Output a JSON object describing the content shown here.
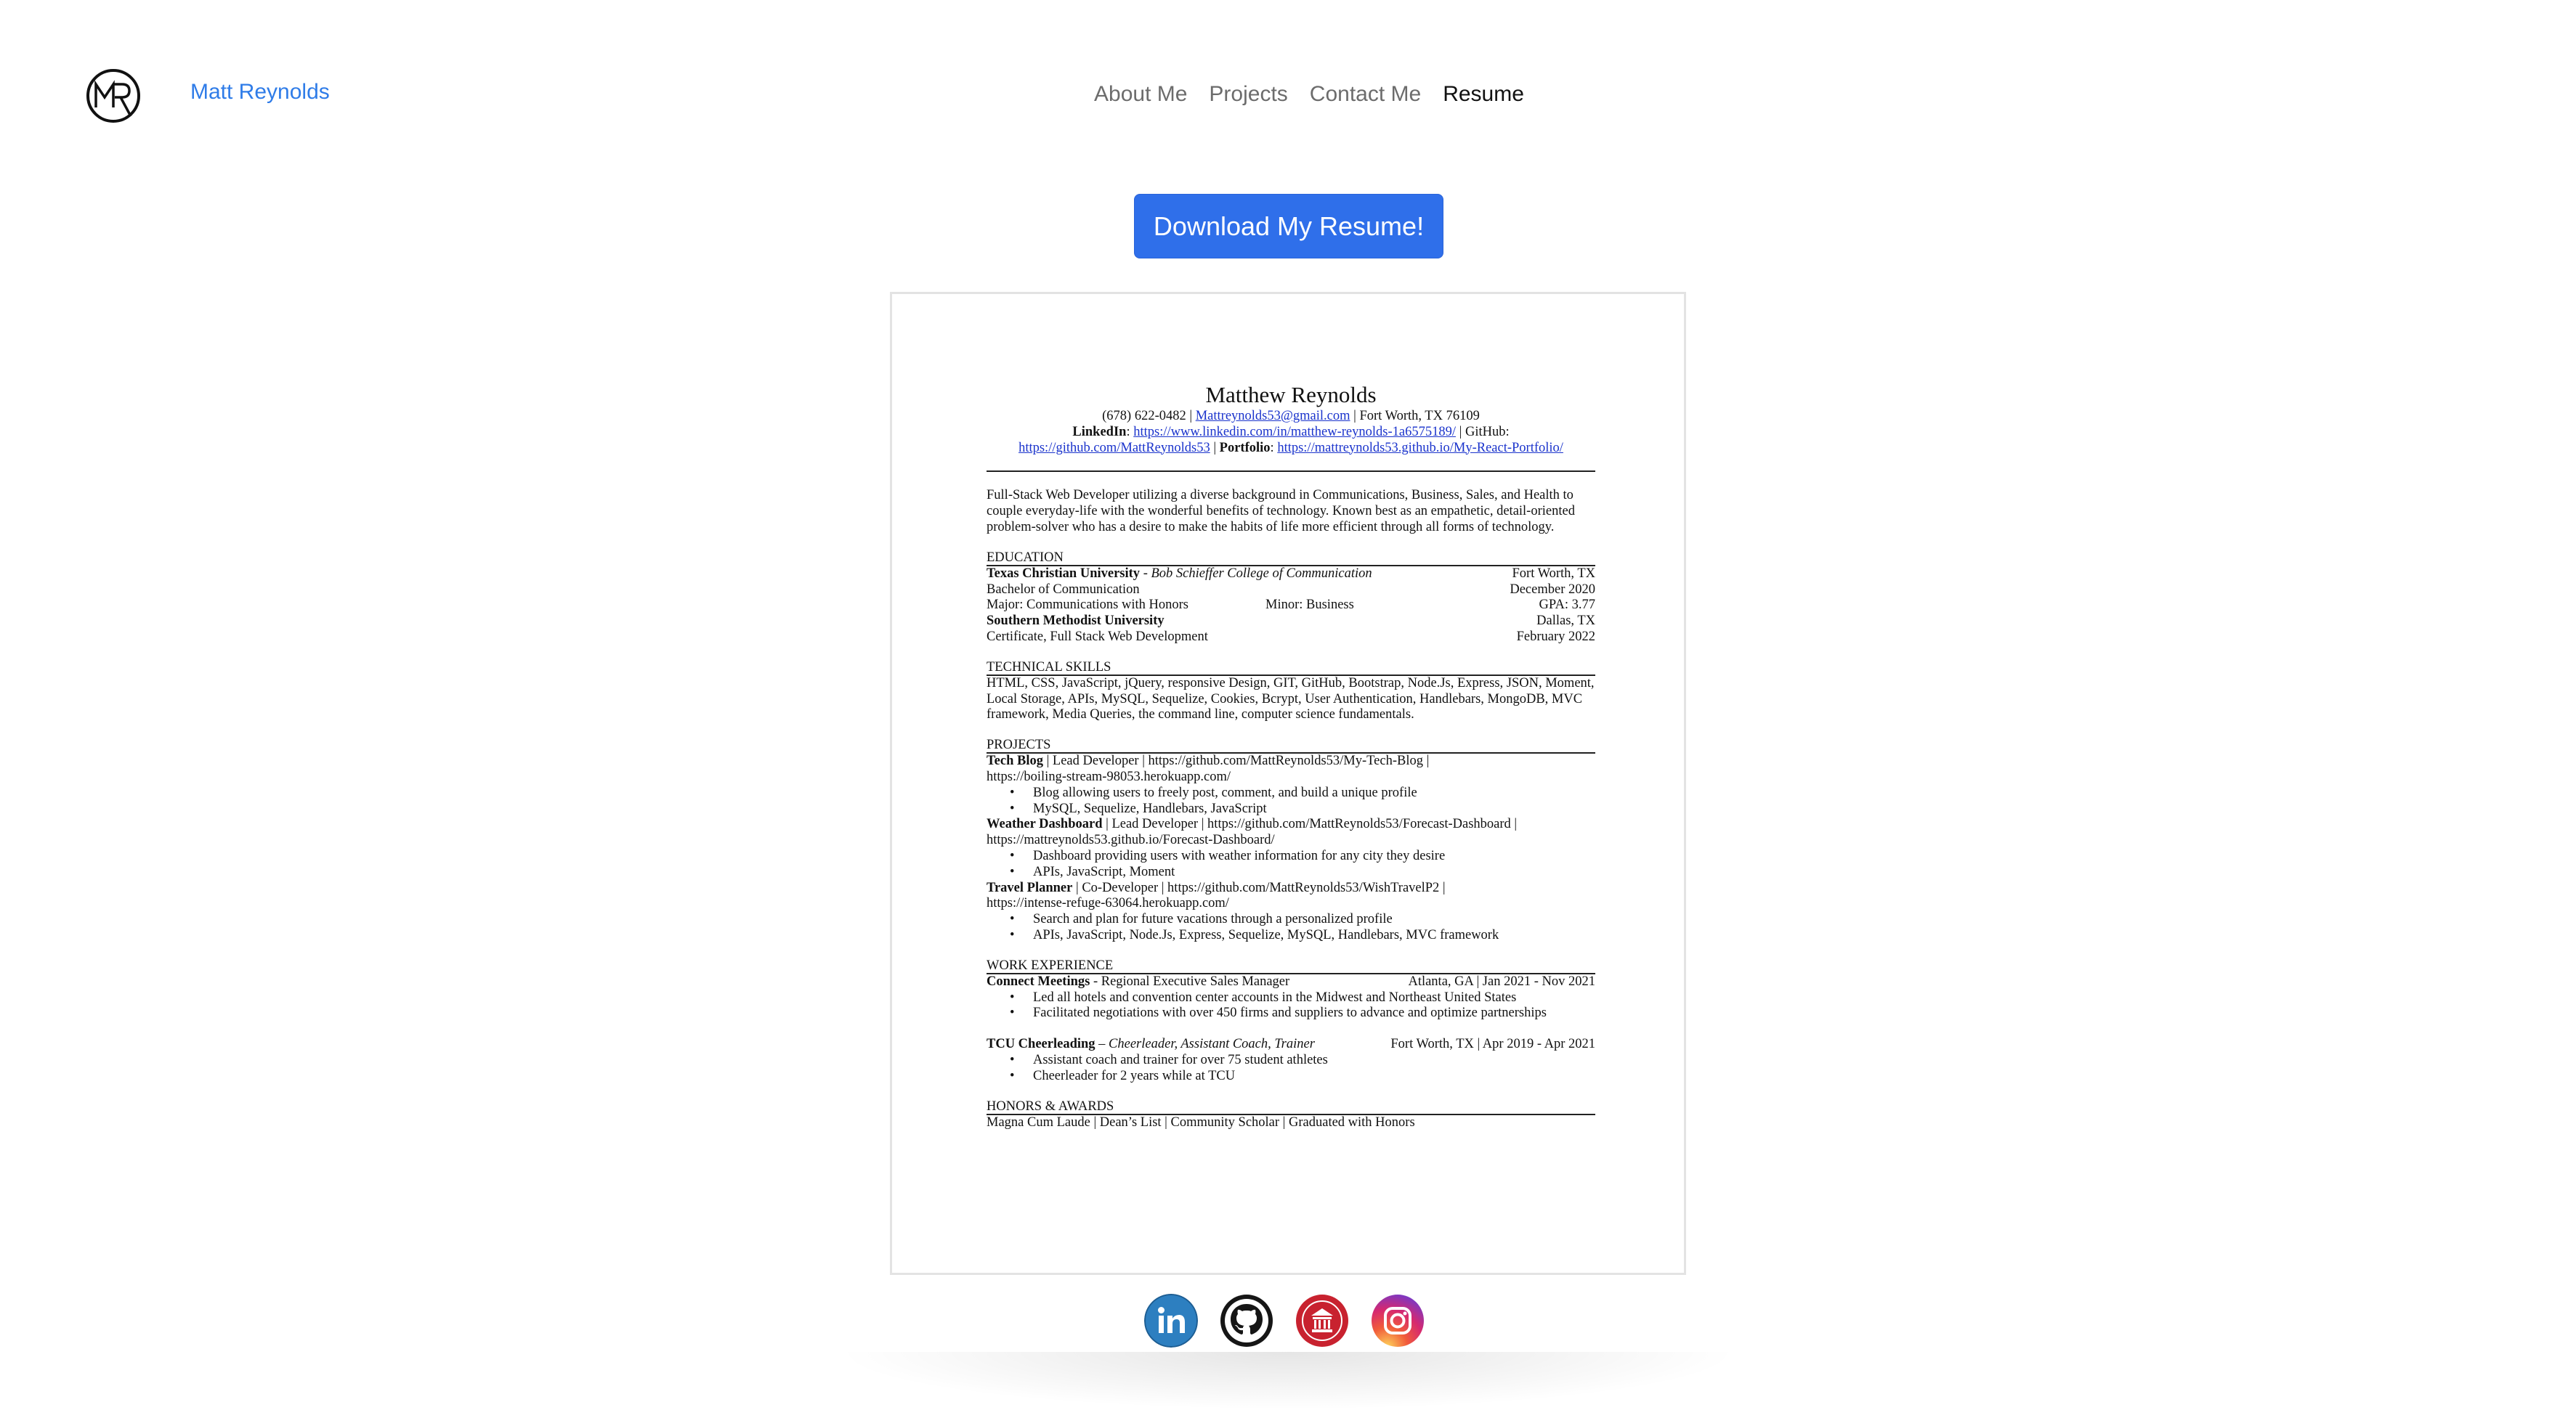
{
  "header": {
    "logo_text": "MR",
    "brand": "Matt Reynolds",
    "nav": [
      {
        "label": "About Me",
        "active": false
      },
      {
        "label": "Projects",
        "active": false
      },
      {
        "label": "Contact Me",
        "active": false
      },
      {
        "label": "Resume",
        "active": true
      }
    ]
  },
  "download_button": "Download My Resume!",
  "resume": {
    "name": "Matthew Reynolds",
    "contact": {
      "phone": "(678) 622-0482",
      "sep": " | ",
      "email": "Mattreynolds53@gmail.com",
      "location": "Fort Worth, TX 76109",
      "linkedin_label": "LinkedIn",
      "linkedin_url": "https://www.linkedin.com/in/matthew-reynolds-1a6575189/",
      "github_label": "GitHub:",
      "github_url": "https://github.com/MattReynolds53",
      "portfolio_label": "Portfolio",
      "portfolio_url": "https://mattreynolds53.github.io/My-React-Portfolio/"
    },
    "summary": "Full-Stack Web Developer utilizing a diverse background in Communications, Business, Sales, and Health to couple everyday-life with the wonderful benefits of technology. Known best as an empathetic, detail-oriented problem-solver who has a desire to make the habits of life more efficient through all forms of technology.",
    "education": {
      "heading": "EDUCATION",
      "tcu_name": "Texas Christian University",
      "tcu_college": " - Bob Schieffer College of Communication",
      "tcu_location": "Fort Worth, TX",
      "tcu_degree": "Bachelor of Communication",
      "tcu_date": "December 2020",
      "tcu_major": "Major: Communications with Honors",
      "tcu_minor": "Minor: Business",
      "tcu_gpa": "GPA: 3.77",
      "smu_name": "Southern Methodist University",
      "smu_location": "Dallas, TX",
      "smu_cert": "Certificate, Full Stack Web Development",
      "smu_date": "February 2022"
    },
    "skills": {
      "heading": "TECHNICAL SKILLS",
      "text": "HTML, CSS, JavaScript, jQuery, responsive Design, GIT, GitHub, Bootstrap, Node.Js, Express, JSON, Moment, Local Storage, APIs, MySQL, Sequelize, Cookies, Bcrypt, User Authentication, Handlebars, MongoDB, MVC framework, Media Queries, the command line, computer science fundamentals."
    },
    "projects": {
      "heading": "PROJECTS",
      "items": [
        {
          "title": "Tech Blog",
          "line1": " | Lead Developer | https://github.com/MattReynolds53/My-Tech-Blog |",
          "line2": "https://boiling-stream-98053.herokuapp.com/",
          "bullets": [
            "Blog allowing users to freely post, comment, and build a unique profile",
            "MySQL, Sequelize, Handlebars, JavaScript"
          ]
        },
        {
          "title": "Weather Dashboard",
          "line1": " | Lead Developer | https://github.com/MattReynolds53/Forecast-Dashboard |",
          "line2": "https://mattreynolds53.github.io/Forecast-Dashboard/",
          "bullets": [
            "Dashboard providing users with weather information for any city they desire",
            "APIs, JavaScript, Moment"
          ]
        },
        {
          "title": "Travel Planner",
          "line1": " | Co-Developer | https://github.com/MattReynolds53/WishTravelP2 |",
          "line2": "https://intense-refuge-63064.herokuapp.com/",
          "bullets": [
            "Search and plan for future vacations through a personalized profile",
            "APIs, JavaScript, Node.Js, Express, Sequelize, MySQL, Handlebars, MVC framework"
          ]
        }
      ]
    },
    "work": {
      "heading": "WORK EXPERIENCE",
      "job1_company": "Connect Meetings",
      "job1_role": " - Regional Executive Sales Manager",
      "job1_meta": "Atlanta, GA | Jan 2021 - Nov 2021",
      "job1_bullets": [
        "Led all hotels and convention center accounts in the Midwest and Northeast United States",
        "Facilitated negotiations with over 450 firms and suppliers to advance and optimize partnerships"
      ],
      "job2_company": "TCU Cheerleading",
      "job2_role": " – Cheerleader, Assistant Coach, Trainer",
      "job2_meta": "Fort Worth, TX | Apr 2019 - Apr 2021",
      "job2_bullets": [
        "Assistant coach and trainer for over 75 student athletes",
        "Cheerleader for 2 years while at TCU"
      ]
    },
    "honors": {
      "heading": "HONORS & AWARDS",
      "text": "Magna Cum Laude | Dean’s List | Community Scholar | Graduated with Honors"
    }
  },
  "socials": [
    {
      "name": "linkedin-icon",
      "color": "#2d7fc0",
      "glyph": "in"
    },
    {
      "name": "github-icon",
      "color": "#161616"
    },
    {
      "name": "smu-icon",
      "color": "#c8222f"
    },
    {
      "name": "instagram-icon",
      "color": "#d6296f"
    }
  ]
}
